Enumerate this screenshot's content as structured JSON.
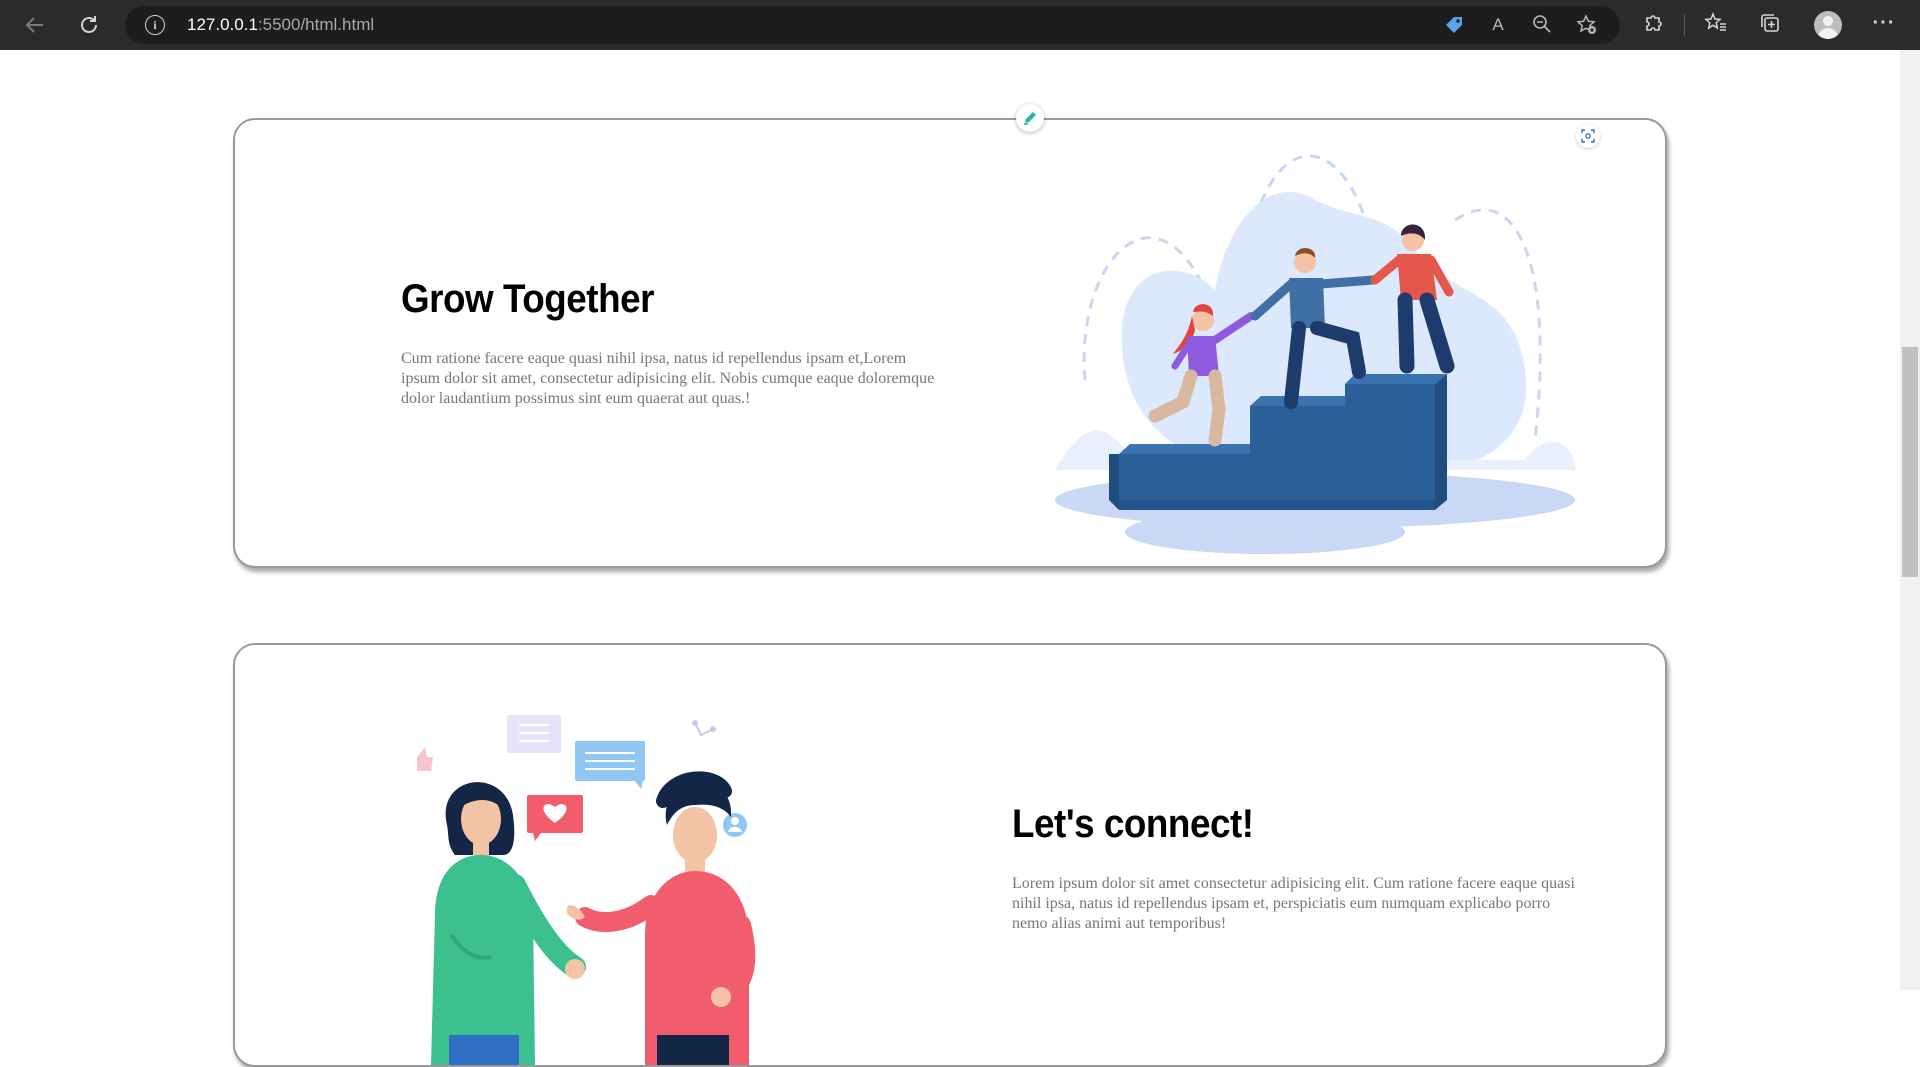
{
  "browser": {
    "url_host": "127.0.0.1",
    "url_rest": ":5500/html.html",
    "icons": [
      "back-arrow-icon",
      "reload-icon",
      "site-info-icon",
      "tag-icon",
      "read-aloud-icon",
      "zoom-out-icon",
      "add-favorite-icon",
      "extensions-icon",
      "favorites-icon",
      "collections-icon",
      "profile-icon",
      "more-icon"
    ],
    "read_aloud_glyph": "A",
    "more_glyph": "···"
  },
  "sections": [
    {
      "title": "Grow Together",
      "text": "Cum ratione facere eaque quasi nihil ipsa, natus id repellendus ipsam et,Lorem ipsum dolor sit amet, consectetur adipisicing elit. Nobis cumque eaque doloremque dolor laudantium possimus sint eum quaerat aut quas.!",
      "illustration": "people-climbing-stairs-illustration"
    },
    {
      "title": "Let's connect!",
      "text": "Lorem ipsum dolor sit amet consectetur adipisicing elit. Cum ratione facere eaque quasi nihil ipsa, natus id repellendus ipsam et, perspiciatis eum numquam explicabo porro nemo alias animi aut temporibus!",
      "illustration": "two-people-chatting-illustration"
    }
  ],
  "colors": {
    "chrome_bg": "#2b2b2b",
    "step_blue": "#2a5f97",
    "blob_blue": "#dce8fb",
    "accent_teal": "#1fb6a6",
    "green_shirt": "#3cc08f",
    "pink_shirt": "#f25d6e"
  }
}
